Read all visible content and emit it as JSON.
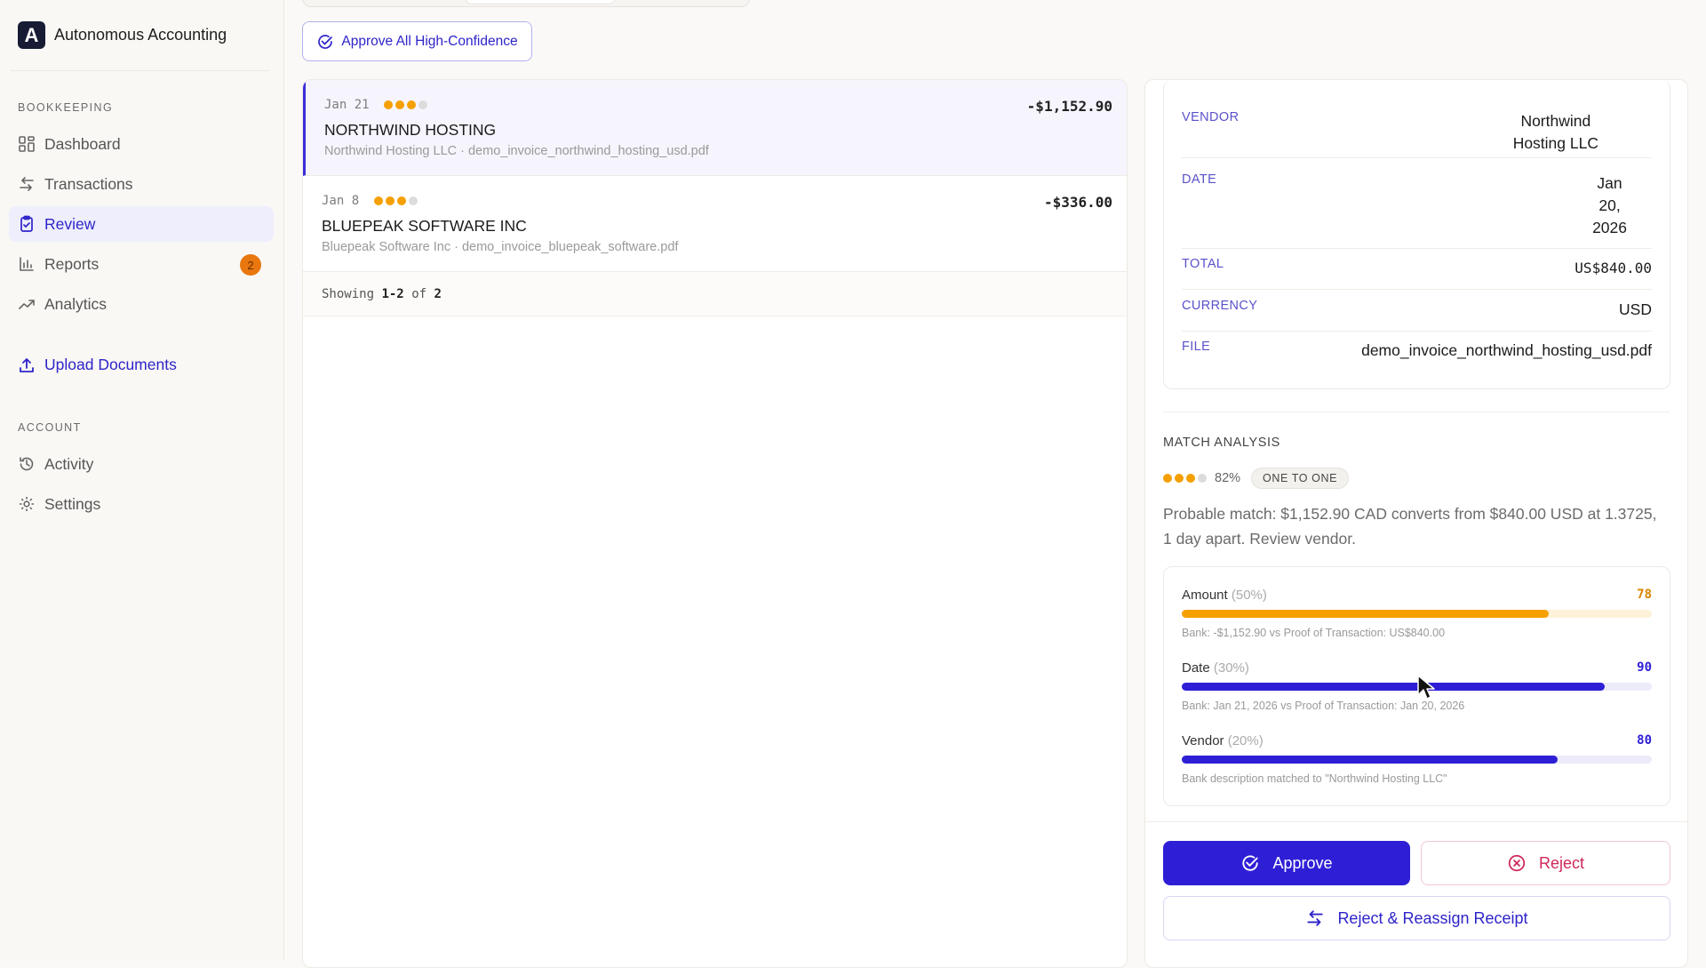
{
  "app": {
    "logo_letter": "A",
    "name": "Autonomous Accounting"
  },
  "sidebar": {
    "bookkeeping_label": "BOOKKEEPING",
    "items": [
      {
        "label": "Dashboard",
        "icon": "dashboard-icon"
      },
      {
        "label": "Transactions",
        "icon": "transactions-icon"
      },
      {
        "label": "Review",
        "icon": "review-icon",
        "active": true
      },
      {
        "label": "Reports",
        "icon": "reports-icon",
        "badge": "2"
      },
      {
        "label": "Analytics",
        "icon": "analytics-icon"
      }
    ],
    "upload_label": "Upload Documents",
    "account_label": "ACCOUNT",
    "account_items": [
      {
        "label": "Activity",
        "icon": "history-icon"
      },
      {
        "label": "Settings",
        "icon": "gear-icon"
      }
    ]
  },
  "toolbar": {
    "approve_all_label": "Approve All High-Confidence"
  },
  "list": {
    "rows": [
      {
        "date": "Jan 21",
        "confidence_dots": 3,
        "name": "NORTHWIND HOSTING",
        "sub": "Northwind Hosting LLC · demo_invoice_northwind_hosting_usd.pdf",
        "amount": "-$1,152.90",
        "selected": true
      },
      {
        "date": "Jan 8",
        "confidence_dots": 3,
        "name": "BLUEPEAK SOFTWARE INC",
        "sub": "Bluepeak Software Inc · demo_invoice_bluepeak_software.pdf",
        "amount": "-$336.00",
        "selected": false
      }
    ],
    "showing_prefix": "Showing",
    "showing_range": "1-2",
    "showing_of": "of",
    "showing_total": "2"
  },
  "detail": {
    "fields": [
      {
        "label": "VENDOR",
        "value_lines": [
          "Northwind",
          "Hosting LLC"
        ]
      },
      {
        "label": "DATE",
        "value_lines": [
          "Jan",
          "20,",
          "2026"
        ]
      },
      {
        "label": "TOTAL",
        "value_lines": [
          "US$840.00"
        ]
      },
      {
        "label": "CURRENCY",
        "value_lines": [
          "USD"
        ]
      },
      {
        "label": "FILE",
        "value_lines": [
          "demo_invoice_northwind_hosting_usd.pdf"
        ]
      }
    ],
    "match_analysis": {
      "title": "MATCH ANALYSIS",
      "confidence_dots": 3,
      "confidence": "82%",
      "type_badge": "ONE TO ONE",
      "description": "Probable match: $1,152.90 CAD converts from $840.00 USD at 1.3725, 1 day apart. Review vendor.",
      "scores": [
        {
          "name": "Amount",
          "weight": "(50%)",
          "value": "78",
          "fraction": 0.78,
          "color": "#f5a000",
          "track": "#fdf1d8",
          "value_color": "#d98400",
          "note": "Bank: -$1,152.90 vs Proof of Transaction: US$840.00"
        },
        {
          "name": "Date",
          "weight": "(30%)",
          "value": "90",
          "fraction": 0.9,
          "color": "#2e1fd6",
          "track": "#ecebfa",
          "value_color": "#2e1fd6",
          "note": "Bank: Jan 21, 2026 vs Proof of Transaction: Jan 20, 2026"
        },
        {
          "name": "Vendor",
          "weight": "(20%)",
          "value": "80",
          "fraction": 0.8,
          "color": "#2e1fd6",
          "track": "#ecebfa",
          "value_color": "#2e1fd6",
          "note": "Bank description matched to \"Northwind Hosting LLC\""
        }
      ]
    },
    "actions": {
      "approve_label": "Approve",
      "reject_label": "Reject",
      "reassign_label": "Reject & Reassign Receipt"
    }
  },
  "colors": {
    "accent": "#2e1fd6",
    "warning": "#f5a000",
    "danger": "#d0285a",
    "badge": "#e8770f"
  }
}
